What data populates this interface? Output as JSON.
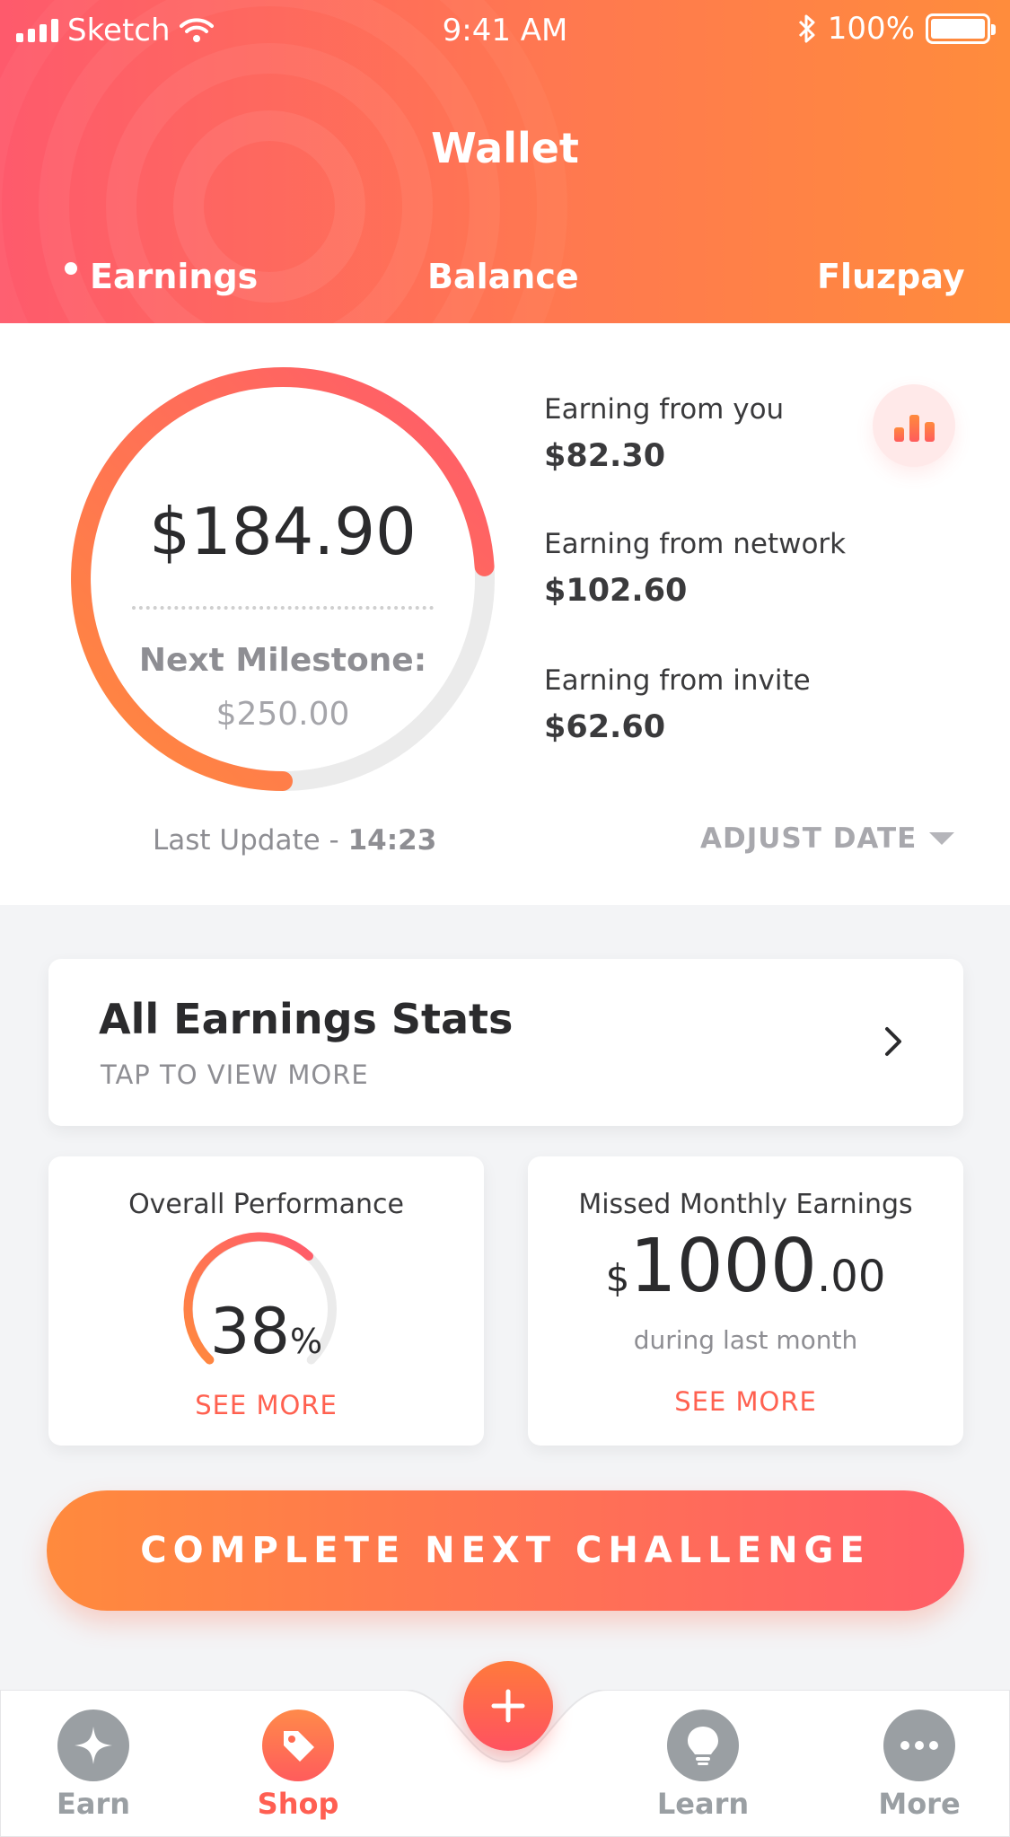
{
  "status_bar": {
    "carrier": "Sketch",
    "time": "9:41 AM",
    "battery": "100%"
  },
  "header": {
    "title": "Wallet",
    "tabs": [
      {
        "label": "Earnings",
        "active": true
      },
      {
        "label": "Balance",
        "active": false
      },
      {
        "label": "Fluzpay",
        "active": false
      }
    ],
    "gradient": [
      "#fe5a6c",
      "#ff8c3c"
    ]
  },
  "summary": {
    "total": "$184.90",
    "milestone_label": "Next Milestone:",
    "milestone_value": "$250.00",
    "progress_fraction": 0.74,
    "earnings": [
      {
        "label": "Earning from you",
        "value": "$82.30"
      },
      {
        "label": "Earning from network",
        "value": "$102.60"
      },
      {
        "label": "Earning from invite",
        "value": "$62.60"
      }
    ],
    "chart_icon": "bar-chart-icon",
    "last_update_prefix": "Last Update - ",
    "last_update_time": "14:23",
    "adjust_date": "ADJUST DATE"
  },
  "stats_card": {
    "title": "All Earnings Stats",
    "subtitle": "TAP TO VIEW MORE",
    "icon": "chevron-right-icon"
  },
  "performance_card": {
    "title": "Overall Performance",
    "percent": "38",
    "percent_sign": "%",
    "see_more": "SEE MORE"
  },
  "missed_card": {
    "title": "Missed Monthly Earnings",
    "currency": "$",
    "amount_whole": "1000",
    "amount_cents": ".00",
    "subtitle": "during last month",
    "see_more": "SEE MORE"
  },
  "cta": {
    "label": "COMPLETE NEXT CHALLENGE"
  },
  "tabbar": {
    "items": [
      {
        "label": "Earn",
        "icon": "sparkle-icon",
        "active": false
      },
      {
        "label": "Shop",
        "icon": "tag-icon",
        "active": true
      },
      {
        "label": "Learn",
        "icon": "lightbulb-icon",
        "active": false
      },
      {
        "label": "More",
        "icon": "more-dots-icon",
        "active": false
      }
    ],
    "fab_icon": "plus-icon",
    "accent": "#ff5f52",
    "inactive": "#9a9fa3"
  }
}
